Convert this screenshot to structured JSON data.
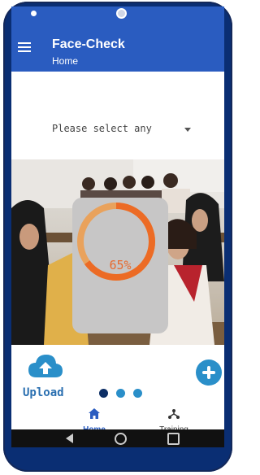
{
  "app": {
    "title": "Face-Check",
    "subtitle": "Home"
  },
  "selector": {
    "label": "Please select any"
  },
  "progress": {
    "text": "65%",
    "value": 0.65,
    "color": "#e76a2f"
  },
  "upload": {
    "label": "Upload"
  },
  "pager": {
    "count": 3,
    "active": 0
  },
  "bottom_nav": {
    "home_label": "Home",
    "training_label": "Training"
  },
  "colors": {
    "app_bar": "#2a5cc0",
    "frame": "#0a2e73",
    "accent": "#2a8fc9"
  }
}
